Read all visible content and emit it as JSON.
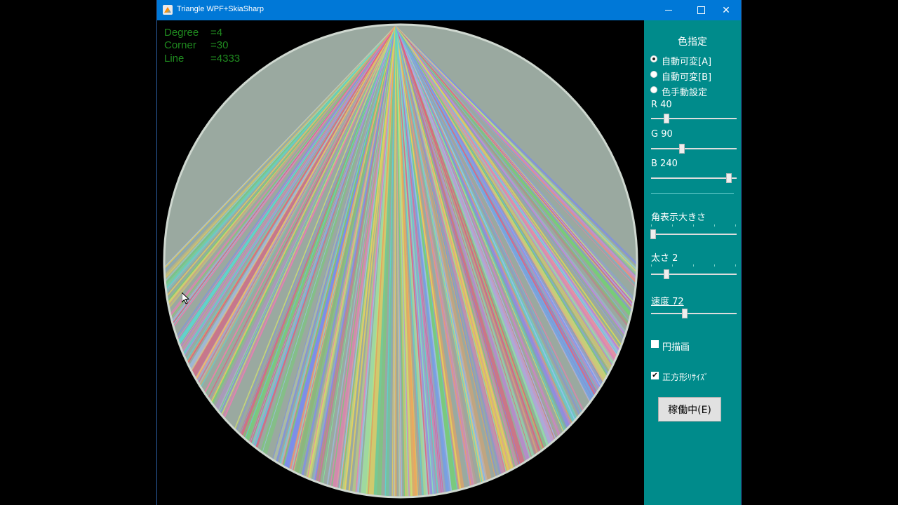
{
  "window": {
    "title": "Triangle WPF+SkiaSharp",
    "minimize_glyph": "minimize-icon",
    "maximize_glyph": "maximize-icon",
    "close_glyph": "✕"
  },
  "info": {
    "degree_label": "Degree",
    "degree_value": "=4",
    "corner_label": "Corner",
    "corner_value": "=30",
    "line_label": "Line",
    "line_value": "=4333",
    "color": "#1f8a1f"
  },
  "panel": {
    "color_heading": "色指定",
    "radio_auto_a": "自動可変[A]",
    "radio_auto_b": "自動可変[B]",
    "radio_manual": "色手動設定",
    "selected_radio": "auto_a",
    "r_label": "R 40",
    "r_value": 40,
    "g_label": "G 90",
    "g_value": 90,
    "b_label": "B 240",
    "b_value": 240,
    "corner_size_label": "角表示大きさ",
    "corner_size_value": 0,
    "thickness_label": "太さ 2",
    "thickness_value": 2,
    "speed_label": "速度 72",
    "speed_value": 72,
    "circle_draw_label": "円描画",
    "circle_draw_checked": false,
    "square_resize_label": "正方形ﾘｻｲｽﾞ",
    "square_resize_checked": true,
    "run_button_label": "稼働中(E)",
    "background": "#008b8b"
  }
}
